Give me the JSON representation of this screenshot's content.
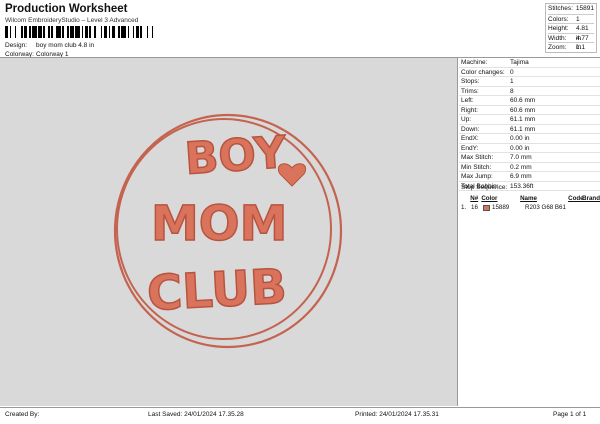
{
  "header": {
    "title": "Production Worksheet",
    "subtitle": "Wilcom EmbroideryStudio – Level 3 Advanced"
  },
  "summary": [
    {
      "label": "Stitches:",
      "value": "15891"
    },
    {
      "label": "Colors:",
      "value": "1"
    },
    {
      "label": "Height:",
      "value": "4.81 in"
    },
    {
      "label": "Width:",
      "value": "4.77 in"
    },
    {
      "label": "Zoom:",
      "value": "1:1"
    }
  ],
  "meta": {
    "design_label": "Design:",
    "design_value": "boy mom club 4.8 in",
    "colorway_label": "Colorway:",
    "colorway_value": "Colorway 1"
  },
  "design": {
    "thread_color": "#d9735c",
    "thread_shadow": "#b8533f",
    "outline_color": "#c4634f",
    "background": "#d9d9d9",
    "word_1": "BOY",
    "word_2": "MOM",
    "word_3": "CLUB"
  },
  "machine_info": [
    {
      "label": "Machine:",
      "value": "Tajima"
    },
    {
      "label": "Color changes:",
      "value": "0"
    },
    {
      "label": "Stops:",
      "value": "1"
    },
    {
      "label": "Trims:",
      "value": "8"
    },
    {
      "label": "Left:",
      "value": "60.6 mm"
    },
    {
      "label": "Right:",
      "value": "60.6 mm"
    },
    {
      "label": "Up:",
      "value": "61.1 mm"
    },
    {
      "label": "Down:",
      "value": "61.1 mm"
    },
    {
      "label": "EndX:",
      "value": "0.00 in"
    },
    {
      "label": "EndY:",
      "value": "0.00 in"
    },
    {
      "label": "Max Stitch:",
      "value": "7.0 mm"
    },
    {
      "label": "Min Stitch:",
      "value": "0.2 mm"
    },
    {
      "label": "Max Jump:",
      "value": "6.9 mm"
    },
    {
      "label": "Total Bobbin:",
      "value": "153.36ft"
    }
  ],
  "stop_sequence": {
    "title": "Stop Sequence:",
    "headers": [
      "",
      "N#",
      "Color",
      "Name",
      "Code",
      "Brand"
    ],
    "rows": [
      {
        "index": "1.",
        "n": "16",
        "swatch": "#d9735c",
        "color": "15889",
        "name": "R203 G68 B61",
        "code": "",
        "brand": ""
      }
    ]
  },
  "footer": {
    "created_by": "Created By:",
    "last_saved": "Last Saved: 24/01/2024 17.35.28",
    "printed": "Printed: 24/01/2024 17.35.31",
    "page": "Page 1 of 1"
  }
}
